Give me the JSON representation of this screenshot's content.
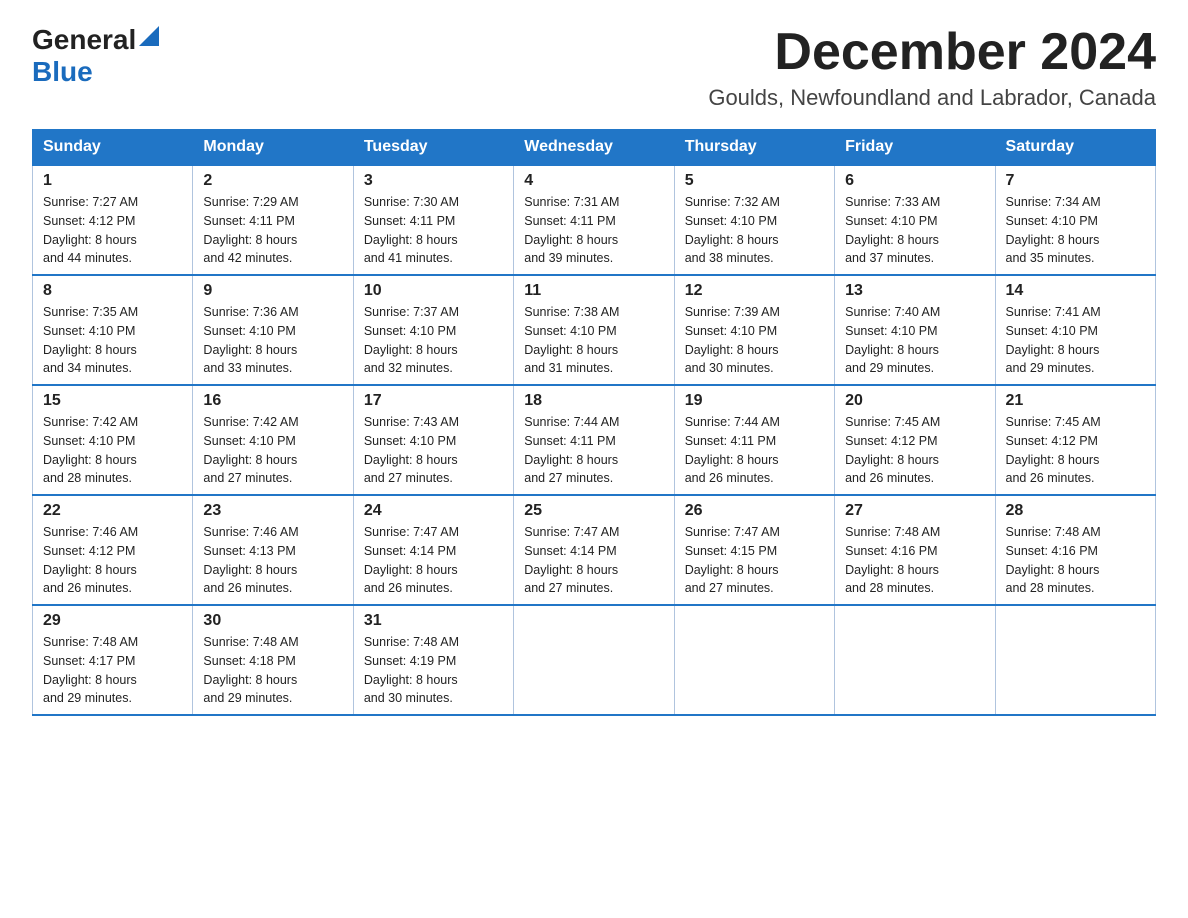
{
  "header": {
    "logo_line1": "General",
    "logo_line2": "Blue",
    "month_title": "December 2024",
    "location": "Goulds, Newfoundland and Labrador, Canada"
  },
  "weekdays": [
    "Sunday",
    "Monday",
    "Tuesday",
    "Wednesday",
    "Thursday",
    "Friday",
    "Saturday"
  ],
  "weeks": [
    [
      {
        "day": "1",
        "sunrise": "7:27 AM",
        "sunset": "4:12 PM",
        "daylight": "8 hours and 44 minutes."
      },
      {
        "day": "2",
        "sunrise": "7:29 AM",
        "sunset": "4:11 PM",
        "daylight": "8 hours and 42 minutes."
      },
      {
        "day": "3",
        "sunrise": "7:30 AM",
        "sunset": "4:11 PM",
        "daylight": "8 hours and 41 minutes."
      },
      {
        "day": "4",
        "sunrise": "7:31 AM",
        "sunset": "4:11 PM",
        "daylight": "8 hours and 39 minutes."
      },
      {
        "day": "5",
        "sunrise": "7:32 AM",
        "sunset": "4:10 PM",
        "daylight": "8 hours and 38 minutes."
      },
      {
        "day": "6",
        "sunrise": "7:33 AM",
        "sunset": "4:10 PM",
        "daylight": "8 hours and 37 minutes."
      },
      {
        "day": "7",
        "sunrise": "7:34 AM",
        "sunset": "4:10 PM",
        "daylight": "8 hours and 35 minutes."
      }
    ],
    [
      {
        "day": "8",
        "sunrise": "7:35 AM",
        "sunset": "4:10 PM",
        "daylight": "8 hours and 34 minutes."
      },
      {
        "day": "9",
        "sunrise": "7:36 AM",
        "sunset": "4:10 PM",
        "daylight": "8 hours and 33 minutes."
      },
      {
        "day": "10",
        "sunrise": "7:37 AM",
        "sunset": "4:10 PM",
        "daylight": "8 hours and 32 minutes."
      },
      {
        "day": "11",
        "sunrise": "7:38 AM",
        "sunset": "4:10 PM",
        "daylight": "8 hours and 31 minutes."
      },
      {
        "day": "12",
        "sunrise": "7:39 AM",
        "sunset": "4:10 PM",
        "daylight": "8 hours and 30 minutes."
      },
      {
        "day": "13",
        "sunrise": "7:40 AM",
        "sunset": "4:10 PM",
        "daylight": "8 hours and 29 minutes."
      },
      {
        "day": "14",
        "sunrise": "7:41 AM",
        "sunset": "4:10 PM",
        "daylight": "8 hours and 29 minutes."
      }
    ],
    [
      {
        "day": "15",
        "sunrise": "7:42 AM",
        "sunset": "4:10 PM",
        "daylight": "8 hours and 28 minutes."
      },
      {
        "day": "16",
        "sunrise": "7:42 AM",
        "sunset": "4:10 PM",
        "daylight": "8 hours and 27 minutes."
      },
      {
        "day": "17",
        "sunrise": "7:43 AM",
        "sunset": "4:10 PM",
        "daylight": "8 hours and 27 minutes."
      },
      {
        "day": "18",
        "sunrise": "7:44 AM",
        "sunset": "4:11 PM",
        "daylight": "8 hours and 27 minutes."
      },
      {
        "day": "19",
        "sunrise": "7:44 AM",
        "sunset": "4:11 PM",
        "daylight": "8 hours and 26 minutes."
      },
      {
        "day": "20",
        "sunrise": "7:45 AM",
        "sunset": "4:12 PM",
        "daylight": "8 hours and 26 minutes."
      },
      {
        "day": "21",
        "sunrise": "7:45 AM",
        "sunset": "4:12 PM",
        "daylight": "8 hours and 26 minutes."
      }
    ],
    [
      {
        "day": "22",
        "sunrise": "7:46 AM",
        "sunset": "4:12 PM",
        "daylight": "8 hours and 26 minutes."
      },
      {
        "day": "23",
        "sunrise": "7:46 AM",
        "sunset": "4:13 PM",
        "daylight": "8 hours and 26 minutes."
      },
      {
        "day": "24",
        "sunrise": "7:47 AM",
        "sunset": "4:14 PM",
        "daylight": "8 hours and 26 minutes."
      },
      {
        "day": "25",
        "sunrise": "7:47 AM",
        "sunset": "4:14 PM",
        "daylight": "8 hours and 27 minutes."
      },
      {
        "day": "26",
        "sunrise": "7:47 AM",
        "sunset": "4:15 PM",
        "daylight": "8 hours and 27 minutes."
      },
      {
        "day": "27",
        "sunrise": "7:48 AM",
        "sunset": "4:16 PM",
        "daylight": "8 hours and 28 minutes."
      },
      {
        "day": "28",
        "sunrise": "7:48 AM",
        "sunset": "4:16 PM",
        "daylight": "8 hours and 28 minutes."
      }
    ],
    [
      {
        "day": "29",
        "sunrise": "7:48 AM",
        "sunset": "4:17 PM",
        "daylight": "8 hours and 29 minutes."
      },
      {
        "day": "30",
        "sunrise": "7:48 AM",
        "sunset": "4:18 PM",
        "daylight": "8 hours and 29 minutes."
      },
      {
        "day": "31",
        "sunrise": "7:48 AM",
        "sunset": "4:19 PM",
        "daylight": "8 hours and 30 minutes."
      },
      null,
      null,
      null,
      null
    ]
  ],
  "labels": {
    "sunrise": "Sunrise:",
    "sunset": "Sunset:",
    "daylight": "Daylight:"
  }
}
